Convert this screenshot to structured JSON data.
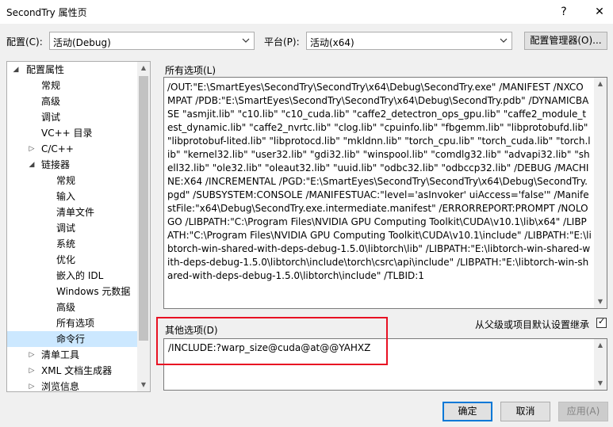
{
  "window": {
    "title": "SecondTry 属性页",
    "help_glyph": "?",
    "close_glyph": "✕"
  },
  "toolbar": {
    "config_label": "配置(C):",
    "config_value": "活动(Debug)",
    "platform_label": "平台(P):",
    "platform_value": "活动(x64)",
    "config_manager_label": "配置管理器(O)..."
  },
  "tree": {
    "items": [
      {
        "label": "配置属性",
        "expander": "◢"
      },
      {
        "label": "常规"
      },
      {
        "label": "高级"
      },
      {
        "label": "调试"
      },
      {
        "label": "VC++ 目录"
      },
      {
        "label": "C/C++",
        "expander": "▷"
      },
      {
        "label": "链接器",
        "expander": "◢"
      },
      {
        "label": "常规"
      },
      {
        "label": "输入"
      },
      {
        "label": "清单文件"
      },
      {
        "label": "调试"
      },
      {
        "label": "系统"
      },
      {
        "label": "优化"
      },
      {
        "label": "嵌入的 IDL"
      },
      {
        "label": "Windows 元数据"
      },
      {
        "label": "高级"
      },
      {
        "label": "所有选项"
      },
      {
        "label": "命令行",
        "selected": true
      },
      {
        "label": "清单工具",
        "expander": "▷"
      },
      {
        "label": "XML 文档生成器",
        "expander": "▷"
      },
      {
        "label": "浏览信息",
        "expander": "▷"
      }
    ]
  },
  "all_options": {
    "label": "所有选项(L)",
    "text": "/OUT:\"E:\\SmartEyes\\SecondTry\\SecondTry\\x64\\Debug\\SecondTry.exe\" /MANIFEST /NXCOMPAT /PDB:\"E:\\SmartEyes\\SecondTry\\SecondTry\\x64\\Debug\\SecondTry.pdb\" /DYNAMICBASE \"asmjit.lib\" \"c10.lib\" \"c10_cuda.lib\" \"caffe2_detectron_ops_gpu.lib\" \"caffe2_module_test_dynamic.lib\" \"caffe2_nvrtc.lib\" \"clog.lib\" \"cpuinfo.lib\" \"fbgemm.lib\" \"libprotobufd.lib\" \"libprotobuf-lited.lib\" \"libprotocd.lib\" \"mkldnn.lib\" \"torch_cpu.lib\" \"torch_cuda.lib\" \"torch.lib\" \"kernel32.lib\" \"user32.lib\" \"gdi32.lib\" \"winspool.lib\" \"comdlg32.lib\" \"advapi32.lib\" \"shell32.lib\" \"ole32.lib\" \"oleaut32.lib\" \"uuid.lib\" \"odbc32.lib\" \"odbccp32.lib\" /DEBUG /MACHINE:X64 /INCREMENTAL /PGD:\"E:\\SmartEyes\\SecondTry\\SecondTry\\x64\\Debug\\SecondTry.pgd\" /SUBSYSTEM:CONSOLE /MANIFESTUAC:\"level='asInvoker' uiAccess='false'\" /ManifestFile:\"x64\\Debug\\SecondTry.exe.intermediate.manifest\" /ERRORREPORT:PROMPT /NOLOGO /LIBPATH:\"C:\\Program Files\\NVIDIA GPU Computing Toolkit\\CUDA\\v10.1\\lib\\x64\" /LIBPATH:\"C:\\Program Files\\NVIDIA GPU Computing Toolkit\\CUDA\\v10.1\\include\" /LIBPATH:\"E:\\libtorch-win-shared-with-deps-debug-1.5.0\\libtorch\\lib\" /LIBPATH:\"E:\\libtorch-win-shared-with-deps-debug-1.5.0\\libtorch\\include\\torch\\csrc\\api\\include\" /LIBPATH:\"E:\\libtorch-win-shared-with-deps-debug-1.5.0\\libtorch\\include\" /TLBID:1"
  },
  "other_options": {
    "label": "其他选项(D)",
    "value": "/INCLUDE:?warp_size@cuda@at@@YAHXZ"
  },
  "inherit": {
    "label": "从父级或项目默认设置继承",
    "checked": true,
    "check_glyph": "✓"
  },
  "buttons": {
    "ok": "确定",
    "cancel": "取消",
    "apply": "应用(A)"
  }
}
